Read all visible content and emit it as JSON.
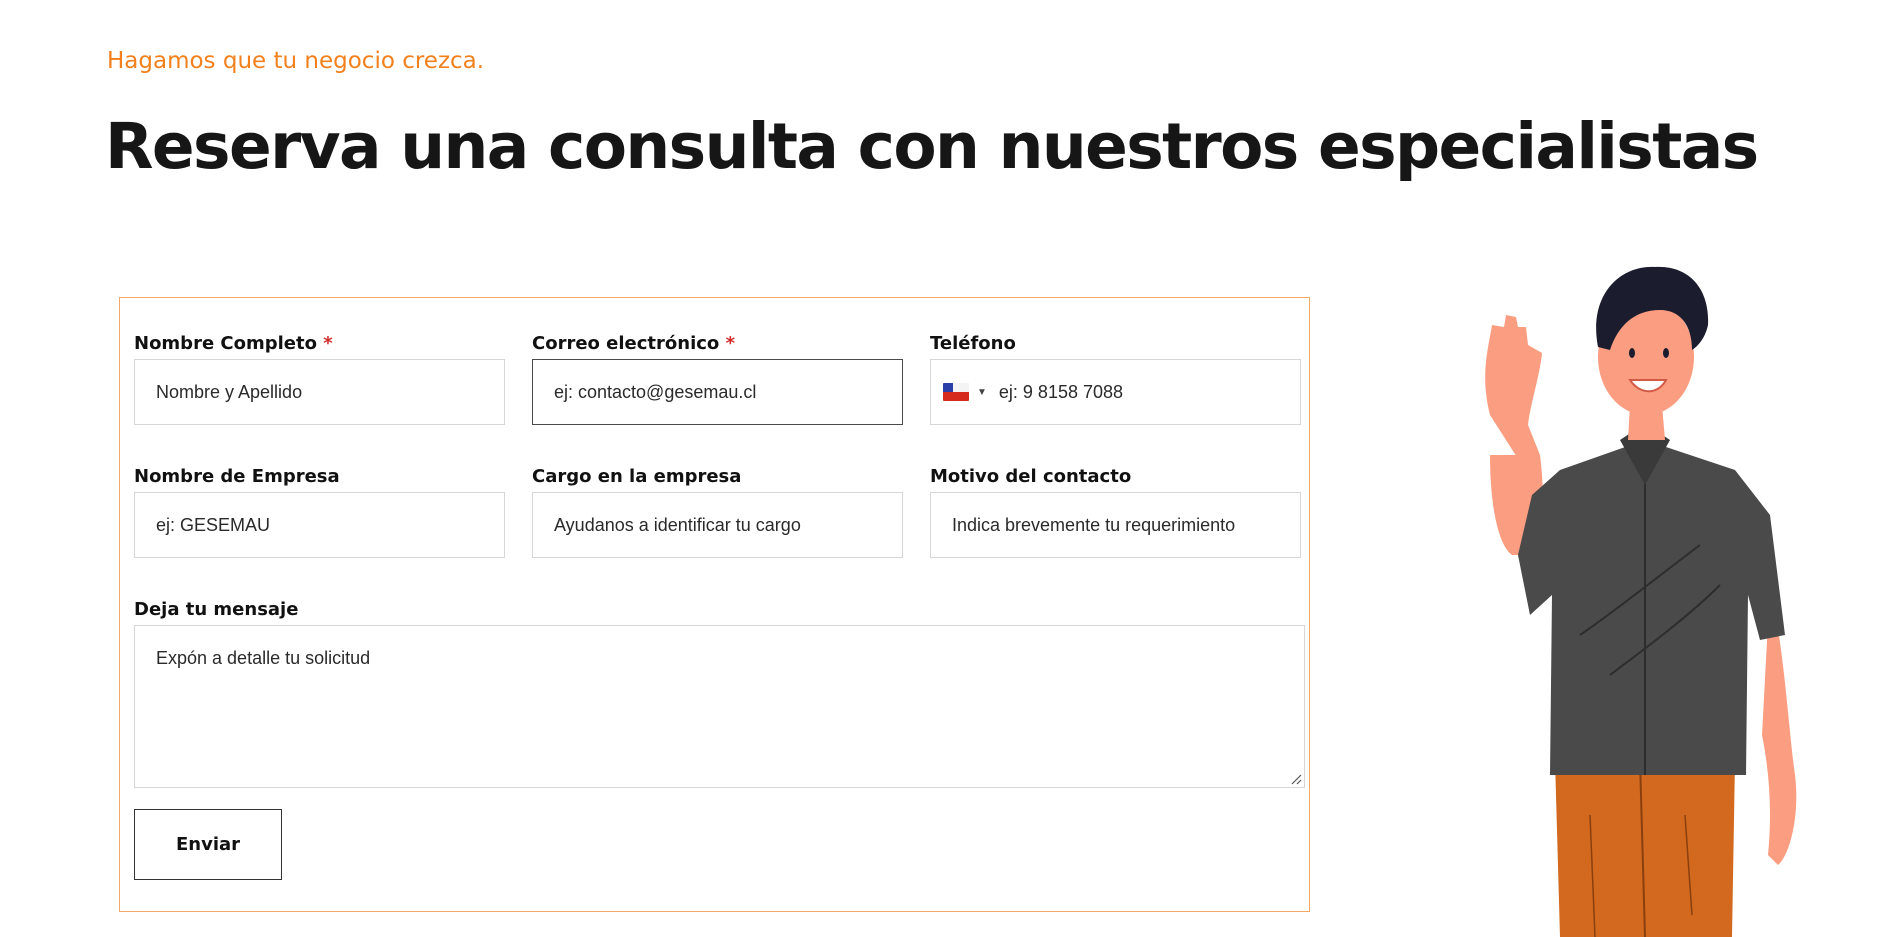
{
  "header": {
    "eyebrow": "Hagamos que tu negocio crezca.",
    "title": "Reserva una consulta con nuestros especialistas"
  },
  "form": {
    "required_marker": "*",
    "fields": {
      "full_name": {
        "label": "Nombre Completo",
        "placeholder": "Nombre y Apellido",
        "required": true
      },
      "email": {
        "label": "Correo electrónico",
        "placeholder": "ej: contacto@gesemau.cl",
        "required": true
      },
      "phone": {
        "label": "Teléfono",
        "placeholder": "ej: 9 8158 7088",
        "country_flag": "chile-flag-icon"
      },
      "company": {
        "label": "Nombre de Empresa",
        "placeholder": "ej: GESEMAU"
      },
      "position": {
        "label": "Cargo en la empresa",
        "placeholder": "Ayudanos a identificar tu cargo"
      },
      "reason": {
        "label": "Motivo del contacto",
        "placeholder": "Indica brevemente tu requerimiento"
      },
      "message": {
        "label": "Deja tu mensaje",
        "placeholder": "Expón a detalle tu solicitud"
      }
    },
    "submit_label": "Enviar"
  },
  "colors": {
    "accent_orange": "#f2811d",
    "form_border": "#f5a767",
    "required_red": "#d32b2b",
    "heading": "#161616"
  }
}
